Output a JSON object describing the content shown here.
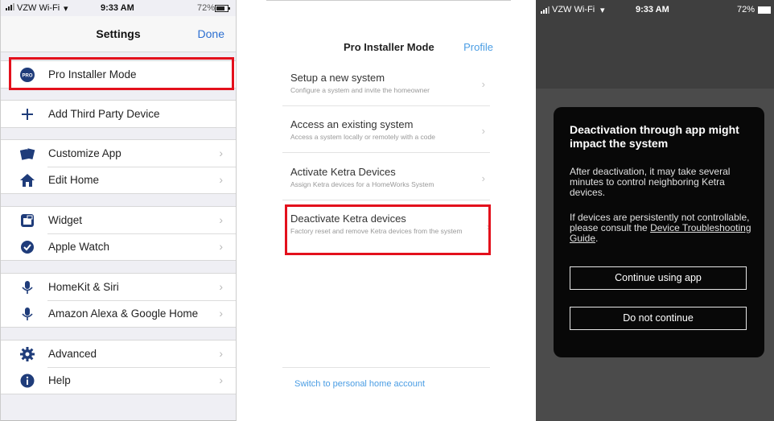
{
  "panel1": {
    "status": {
      "carrier": "VZW Wi-Fi",
      "time": "9:33 AM",
      "battery": "72%"
    },
    "title": "Settings",
    "done": "Done",
    "groups": [
      {
        "items": [
          {
            "label": "Pro Installer Mode",
            "icon": "pro-badge-icon"
          }
        ]
      },
      {
        "items": [
          {
            "label": "Add Third Party Device",
            "icon": "plus-icon"
          }
        ]
      },
      {
        "items": [
          {
            "label": "Customize App",
            "icon": "cards-icon"
          },
          {
            "label": "Edit Home",
            "icon": "house-icon"
          }
        ]
      },
      {
        "items": [
          {
            "label": "Widget",
            "icon": "widget-icon"
          },
          {
            "label": "Apple Watch",
            "icon": "watch-check-icon"
          }
        ]
      },
      {
        "items": [
          {
            "label": "HomeKit & Siri",
            "icon": "microphone-icon"
          },
          {
            "label": "Amazon Alexa & Google Home",
            "icon": "microphone-icon"
          }
        ]
      },
      {
        "items": [
          {
            "label": "Advanced",
            "icon": "gear-icon"
          },
          {
            "label": "Help",
            "icon": "info-icon"
          }
        ]
      }
    ],
    "pro_badge_text": "PRO"
  },
  "panel2": {
    "title": "Pro Installer Mode",
    "profile": "Profile",
    "options": [
      {
        "title": "Setup a new system",
        "subtitle": "Configure a system and invite the homeowner"
      },
      {
        "title": "Access an existing system",
        "subtitle": "Access a system locally or remotely with a code"
      },
      {
        "title": "Activate Ketra Devices",
        "subtitle": "Assign Ketra devices for a HomeWorks System"
      },
      {
        "title": "Deactivate Ketra devices",
        "subtitle": "Factory reset and remove Ketra devices from the system"
      }
    ],
    "switch_link": "Switch to personal home account"
  },
  "panel3": {
    "status": {
      "carrier": "VZW Wi-Fi",
      "time": "9:33 AM",
      "battery": "72%"
    },
    "dialog": {
      "title": "Deactivation through app might impact the system",
      "body1": "After deactivation, it may take several minutes to control neighboring Ketra devices.",
      "body2_prefix": "If devices are persistently not controllable, please consult the",
      "body2_link": "Device Troubleshooting Guide",
      "body2_suffix": ".",
      "continue_button": "Continue using app",
      "cancel_button": "Do not continue"
    }
  },
  "colors": {
    "highlight": "#e3101c",
    "ios_blue": "#2c6fd1",
    "link_blue": "#4a9de4",
    "icon_navy": "#1f3c7a"
  }
}
